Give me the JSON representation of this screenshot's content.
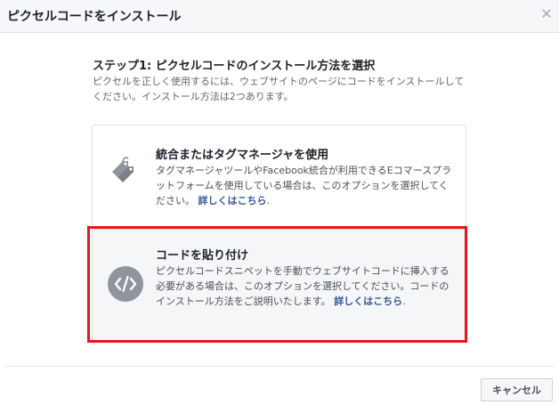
{
  "dialog": {
    "title": "ピクセルコードをインストール",
    "close_icon": "close-icon"
  },
  "step": {
    "title": "ステップ1: ピクセルコードのインストール方法を選択",
    "description": "ピクセルを正しく使用するには、ウェブサイトのページにコードをインストールしてください。インストール方法は2つあります。"
  },
  "options": [
    {
      "icon": "tags-icon",
      "title": "統合またはタグマネージャを使用",
      "description": "タグマネージャツールやFacebook統合が利用できるEコマースプラットフォームを使用している場合は、このオプションを選択してください。",
      "link": "詳しくはこちら",
      "suffix": "."
    },
    {
      "icon": "code-icon",
      "title": "コードを貼り付け",
      "description": "ピクセルコードスニペットを手動でウェブサイトコードに挿入する必要がある場合は、このオプションを選択してください。コードのインストール方法をご説明いたします。",
      "link": "詳しくはこちら",
      "suffix": "."
    }
  ],
  "footer": {
    "cancel_label": "キャンセル"
  },
  "colors": {
    "highlight": "#e0191d",
    "link": "#365899",
    "icon_gray": "#90949c"
  }
}
